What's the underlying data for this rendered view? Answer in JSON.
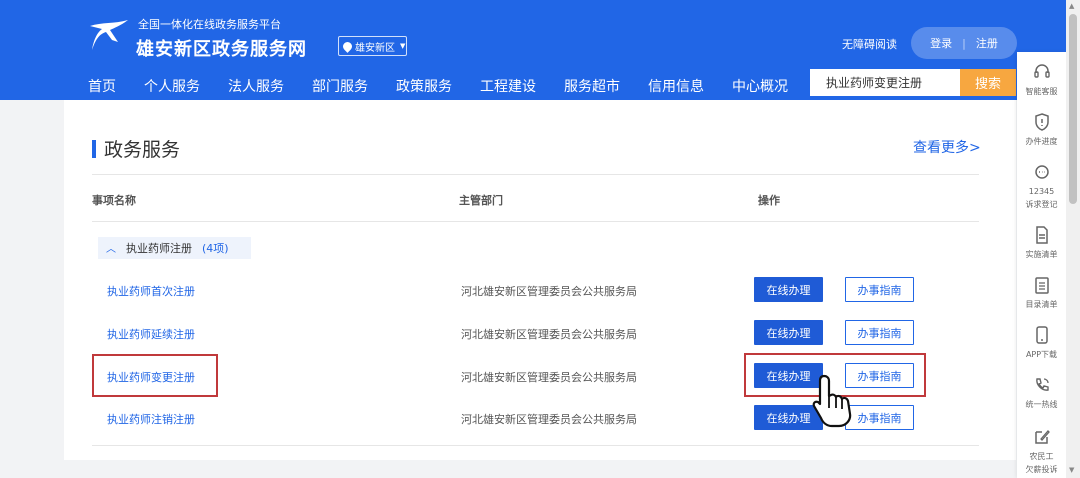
{
  "header": {
    "subtitle": "全国一体化在线政务服务平台",
    "title": "雄安新区政务服务网",
    "region": "雄安新区",
    "accessibility": "无障碍阅读",
    "login": "登录",
    "separator": "|",
    "register": "注册",
    "brand_color": "#2166e6"
  },
  "nav": {
    "items": [
      "首页",
      "个人服务",
      "法人服务",
      "部门服务",
      "政策服务",
      "工程建设",
      "服务超市",
      "信用信息",
      "中心概况"
    ]
  },
  "search": {
    "value": "执业药师变更注册",
    "button": "搜索",
    "button_color": "#f7a740"
  },
  "section": {
    "title": "政务服务",
    "more": "查看更多>"
  },
  "table": {
    "headers": [
      "事项名称",
      "主管部门",
      "操作"
    ],
    "group": {
      "label": "执业药师注册",
      "count": "(4项)"
    },
    "rows": [
      {
        "name": "执业药师首次注册",
        "dept": "河北雄安新区管理委员会公共服务局",
        "online": "在线办理",
        "guide": "办事指南"
      },
      {
        "name": "执业药师延续注册",
        "dept": "河北雄安新区管理委员会公共服务局",
        "online": "在线办理",
        "guide": "办事指南"
      },
      {
        "name": "执业药师变更注册",
        "dept": "河北雄安新区管理委员会公共服务局",
        "online": "在线办理",
        "guide": "办事指南"
      },
      {
        "name": "执业药师注销注册",
        "dept": "河北雄安新区管理委员会公共服务局",
        "online": "在线办理",
        "guide": "办事指南"
      }
    ],
    "highlight_color": "#c0393b"
  },
  "sidebar": {
    "items": [
      {
        "icon": "headset-icon",
        "label": "智能客服"
      },
      {
        "icon": "shield-icon",
        "label": "办件进度"
      },
      {
        "icon": "support-icon",
        "label": "12345",
        "label2": "诉求登记"
      },
      {
        "icon": "document-icon",
        "label": "实施清单"
      },
      {
        "icon": "clipboard-icon",
        "label": "目录清单"
      },
      {
        "icon": "phone-icon",
        "label": "APP下载"
      },
      {
        "icon": "hotline-icon",
        "label": "统一热线"
      },
      {
        "icon": "edit-icon",
        "label": "农民工",
        "label2": "欠薪投诉"
      }
    ]
  }
}
